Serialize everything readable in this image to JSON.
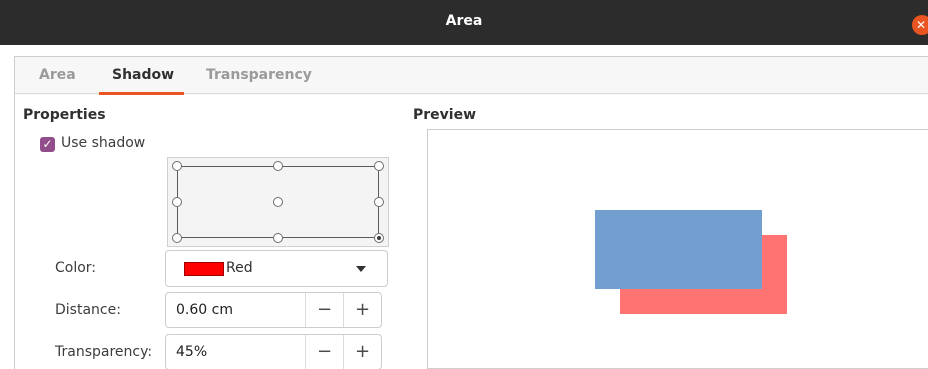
{
  "window": {
    "title": "Area",
    "close_icon": "close-icon",
    "accent": "#e95420"
  },
  "tabs": [
    {
      "label": "Area",
      "active": false
    },
    {
      "label": "Shadow",
      "active": true
    },
    {
      "label": "Transparency",
      "active": false
    }
  ],
  "properties": {
    "heading": "Properties",
    "use_shadow": {
      "label": "Use shadow",
      "checked": true,
      "color": "#924d8b"
    },
    "position_grid": {
      "selected": "bottom-right"
    },
    "color": {
      "label": "Color:",
      "value": "Red",
      "swatch": "#ff0000"
    },
    "distance": {
      "label": "Distance:",
      "value": "0.60 cm",
      "minus": "−",
      "plus": "+"
    },
    "transparency": {
      "label": "Transparency:",
      "value": "45%",
      "minus": "−",
      "plus": "+"
    }
  },
  "preview": {
    "heading": "Preview",
    "object_color": "#729fcf",
    "shadow_color": "#ff7373"
  }
}
